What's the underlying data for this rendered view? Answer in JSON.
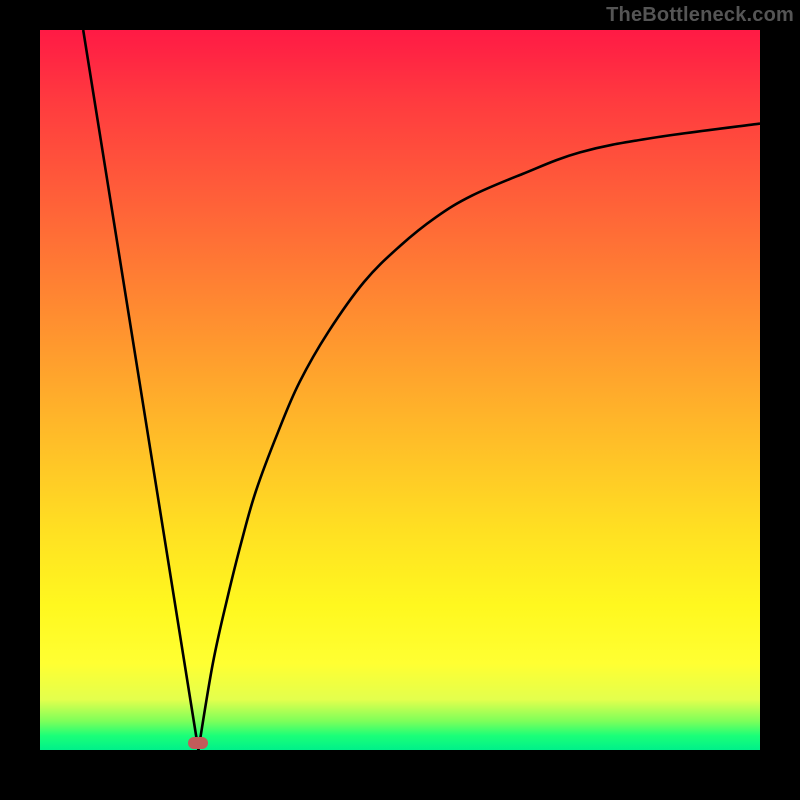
{
  "watermark": "TheBottleneck.com",
  "colors": {
    "black": "#000000",
    "curve": "#000000",
    "marker": "#c25b5a",
    "grad_top": "#ff1a45",
    "grad_mid": "#ffe122",
    "grad_bot": "#00f08a"
  },
  "chart_data": {
    "type": "line",
    "title": "",
    "xlabel": "",
    "ylabel": "",
    "xlim": [
      0,
      100
    ],
    "ylim": [
      0,
      100
    ],
    "grid": false,
    "legend": false,
    "annotations": [
      {
        "type": "marker",
        "x": 22,
        "y": 1,
        "shape": "pill",
        "color": "#c25b5a"
      }
    ],
    "series": [
      {
        "name": "left-line",
        "kind": "line",
        "x": [
          6,
          22
        ],
        "y": [
          100,
          0
        ]
      },
      {
        "name": "right-curve",
        "kind": "line",
        "x": [
          22,
          24,
          26,
          28,
          30,
          33,
          36,
          40,
          45,
          50,
          55,
          60,
          67,
          75,
          85,
          100
        ],
        "y": [
          0,
          12,
          21,
          29,
          36,
          44,
          51,
          58,
          65,
          70,
          74,
          77,
          80,
          83,
          85,
          87
        ]
      }
    ]
  }
}
